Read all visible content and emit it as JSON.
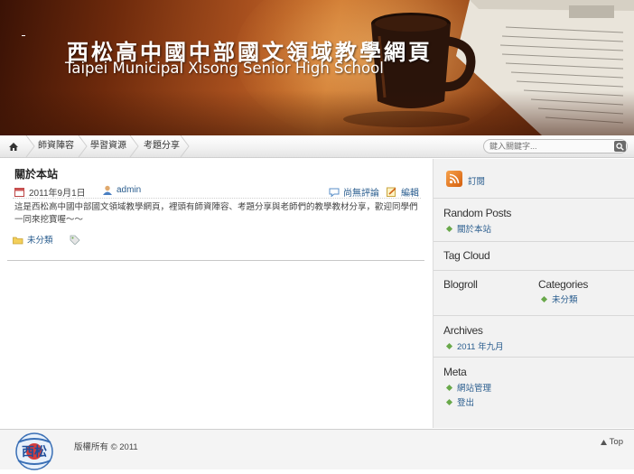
{
  "banner": {
    "title_cn": "西松高中國中部國文領域教學網頁",
    "title_en": "Taipei Municipal Xisong Senior High School"
  },
  "nav": {
    "items": [
      "師資陣容",
      "學習資源",
      "考題分享"
    ],
    "search_placeholder": "鍵入關鍵字..."
  },
  "post": {
    "title": "關於本站",
    "date": "2011年9月1日",
    "author": "admin",
    "comments": "尚無評論",
    "edit": "編輯",
    "body": "這是西松高中國中部國文領域教學網頁，裡頭有師資陣容、考題分享與老師們的教學教材分享，歡迎同學們一同來挖寶喔～～",
    "category": "未分類"
  },
  "sidebar": {
    "rss_label": "訂閱",
    "random_posts": {
      "heading": "Random Posts",
      "items": [
        "關於本站"
      ]
    },
    "tag_cloud": {
      "heading": "Tag Cloud"
    },
    "blogroll": {
      "heading": "Blogroll"
    },
    "categories": {
      "heading": "Categories",
      "items": [
        "未分類"
      ]
    },
    "archives": {
      "heading": "Archives",
      "items": [
        "2011 年九月"
      ]
    },
    "meta": {
      "heading": "Meta",
      "items": [
        "網站管理",
        "登出"
      ]
    }
  },
  "footer": {
    "logo_text": "西松",
    "copyright": "版權所有 © 2011",
    "top_label": "Top"
  },
  "colors": {
    "link": "#2b5e8f",
    "bullet": "#69a84a",
    "rss": "#e8812f"
  }
}
